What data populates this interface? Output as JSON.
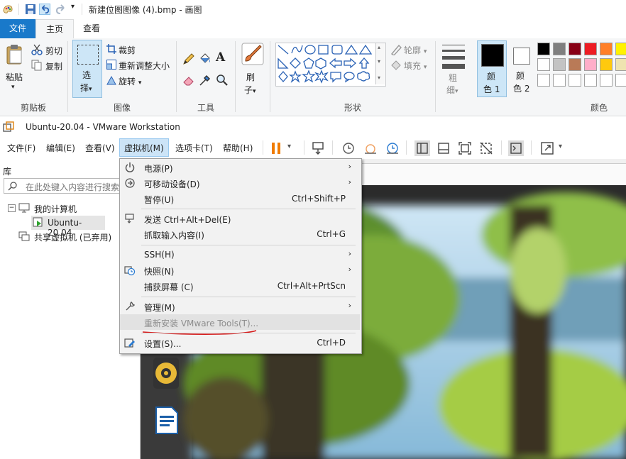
{
  "paint": {
    "title": "新建位图图像 (4).bmp - 画图",
    "tabs": {
      "file": "文件",
      "home": "主页",
      "view": "查看"
    },
    "clipboard": {
      "paste": "粘贴",
      "cut": "剪切",
      "copy": "复制",
      "group": "剪贴板"
    },
    "image": {
      "select_1": "选",
      "select_2": "择",
      "crop": "裁剪",
      "resize": "重新调整大小",
      "rotate": "旋转",
      "group": "图像"
    },
    "tools": {
      "group": "工具"
    },
    "brush": {
      "label_1": "刷",
      "label_2": "子"
    },
    "shapes": {
      "outline": "轮廓",
      "fill": "填充",
      "group": "形状"
    },
    "size": {
      "label_1": "粗",
      "label_2": "细"
    },
    "color1": {
      "label_1": "颜",
      "label_2": "色 1"
    },
    "color2": {
      "label_1": "颜",
      "label_2": "色 2"
    },
    "colors": {
      "group": "颜色",
      "color1_value": "#000000",
      "color2_value": "#ffffff",
      "palette_row1": [
        "#000000",
        "#7f7f7f",
        "#880015",
        "#ed1c24",
        "#ff7f27",
        "#fff200"
      ],
      "palette_row2": [
        "#ffffff",
        "#c3c3c3",
        "#b97a57",
        "#ffaec9",
        "#ffc90e",
        "#efe4b0"
      ],
      "palette_row3": [
        "#ffffff",
        "#ffffff",
        "#ffffff",
        "#ffffff",
        "#ffffff",
        "#ffffff"
      ]
    }
  },
  "vmware": {
    "title": "Ubuntu-20.04 - VMware Workstation",
    "menu": {
      "file": "文件(F)",
      "edit": "编辑(E)",
      "view": "查看(V)",
      "vm": "虚拟机(M)",
      "tabs": "选项卡(T)",
      "help": "帮助(H)"
    },
    "library": {
      "title": "库",
      "search_placeholder": "在此处键入内容进行搜索",
      "my_computer": "我的计算机",
      "vm_item": "Ubuntu-20.04",
      "shared": "共享虚拟机 (已弃用)"
    },
    "vm_menu_items": [
      {
        "label": "电源(P)",
        "shortcut": "",
        "submenu": true
      },
      {
        "label": "可移动设备(D)",
        "shortcut": "",
        "submenu": true
      },
      {
        "label": "暂停(U)",
        "shortcut": "Ctrl+Shift+P",
        "submenu": false
      },
      {
        "label": "发送 Ctrl+Alt+Del(E)",
        "shortcut": "",
        "submenu": false
      },
      {
        "label": "抓取输入内容(I)",
        "shortcut": "Ctrl+G",
        "submenu": false
      },
      {
        "label": "SSH(H)",
        "shortcut": "",
        "submenu": true
      },
      {
        "label": "快照(N)",
        "shortcut": "",
        "submenu": true
      },
      {
        "label": "捕获屏幕 (C)",
        "shortcut": "Ctrl+Alt+PrtScn",
        "submenu": false
      },
      {
        "label": "管理(M)",
        "shortcut": "",
        "submenu": true
      },
      {
        "label": "重新安装 VMware Tools(T)...",
        "shortcut": "",
        "submenu": false
      },
      {
        "label": "设置(S)...",
        "shortcut": "Ctrl+D",
        "submenu": false
      }
    ],
    "accent": "#cce4f7"
  }
}
